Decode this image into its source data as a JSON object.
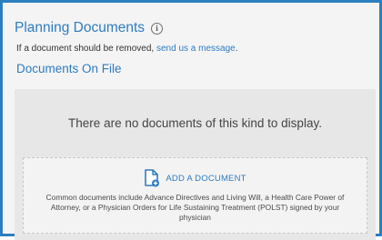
{
  "colors": {
    "accent": "#2f7cc0",
    "frame_border": "#2c7fbf",
    "panel_bg": "#f4f4f4",
    "empty_bg": "#e7e7e7"
  },
  "header": {
    "title": "Planning Documents",
    "info_icon": "info-circle-icon",
    "info_glyph": "i"
  },
  "note": {
    "text": "If a document should be removed, ",
    "link_label": "send us a message",
    "suffix": "."
  },
  "section": {
    "title": "Documents On File"
  },
  "empty_state": {
    "message": "There are no documents of this kind to display."
  },
  "add_document": {
    "icon": "document-add-icon",
    "label": "ADD A DOCUMENT",
    "help_text": "Common documents include Advance Directives and Living Will, a Health Care Power of Attorney, or a Physician Orders for Life Sustaining Treatment (POLST) signed by your physician"
  }
}
